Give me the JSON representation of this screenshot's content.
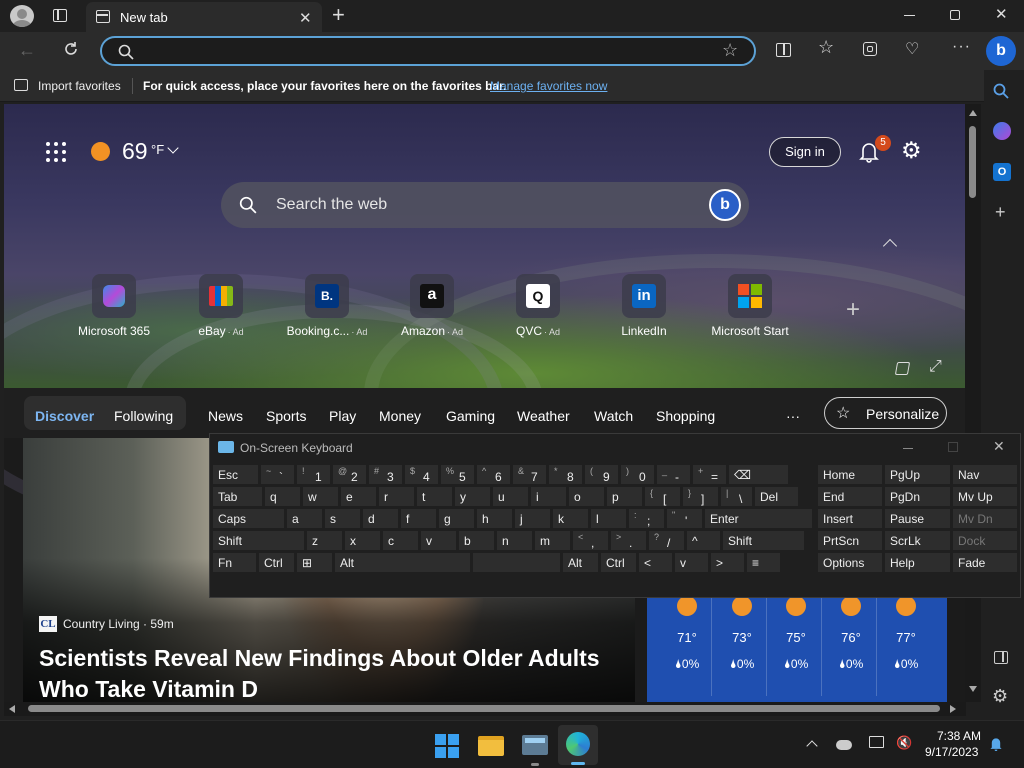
{
  "browser": {
    "tab_title": "New tab",
    "address_value": "",
    "import_favorites": "Import favorites",
    "fav_hint": "For quick access, place your favorites here on the favorites bar.",
    "manage_favorites": "Manage favorites now"
  },
  "hero": {
    "temperature": "69",
    "unit": "°F",
    "sign_in": "Sign in",
    "notification_count": "5",
    "search_placeholder": "Search the web",
    "quick_links": [
      {
        "label": "Microsoft 365",
        "ad": "",
        "icon": "microsoft365-icon"
      },
      {
        "label": "eBay",
        "ad": "· Ad",
        "icon": "ebay-icon"
      },
      {
        "label": "Booking.c...",
        "ad": "· Ad",
        "icon": "booking-icon",
        "glyph": "B."
      },
      {
        "label": "Amazon",
        "ad": "· Ad",
        "icon": "amazon-icon",
        "glyph": "a"
      },
      {
        "label": "QVC",
        "ad": "· Ad",
        "icon": "qvc-icon",
        "glyph": "Q"
      },
      {
        "label": "LinkedIn",
        "ad": "",
        "icon": "linkedin-icon",
        "glyph": "in"
      },
      {
        "label": "Microsoft Start",
        "ad": "",
        "icon": "microsoft-start-icon"
      }
    ]
  },
  "feed_nav": {
    "items": [
      "Discover",
      "Following",
      "News",
      "Sports",
      "Play",
      "Money",
      "Gaming",
      "Weather",
      "Watch",
      "Shopping"
    ],
    "more": "···",
    "personalize": "Personalize"
  },
  "news": {
    "source_badge": "CL",
    "source": "Country Living · 59m",
    "headline_line1": "Scientists Reveal New Findings About Older Adults",
    "headline_line2": "Who Take Vitamin D"
  },
  "weather_forecast": [
    {
      "temp": "71°",
      "precip": "0%"
    },
    {
      "temp": "73°",
      "precip": "0%"
    },
    {
      "temp": "75°",
      "precip": "0%"
    },
    {
      "temp": "76°",
      "precip": "0%"
    },
    {
      "temp": "77°",
      "precip": "0%"
    }
  ],
  "osk": {
    "title": "On-Screen Keyboard",
    "row1": [
      {
        "t": "Esc"
      },
      {
        "u": "~",
        "l": "`"
      },
      {
        "u": "!",
        "l": "1"
      },
      {
        "u": "@",
        "l": "2"
      },
      {
        "u": "#",
        "l": "3"
      },
      {
        "u": "$",
        "l": "4"
      },
      {
        "u": "%",
        "l": "5"
      },
      {
        "u": "^",
        "l": "6"
      },
      {
        "u": "&",
        "l": "7"
      },
      {
        "u": "*",
        "l": "8"
      },
      {
        "u": "(",
        "l": "9"
      },
      {
        "u": ")",
        "l": "0"
      },
      {
        "u": "_",
        "l": "-"
      },
      {
        "u": "+",
        "l": "="
      },
      {
        "t": "⌫"
      }
    ],
    "row2": [
      {
        "t": "Tab"
      },
      {
        "t": "q"
      },
      {
        "t": "w"
      },
      {
        "t": "e"
      },
      {
        "t": "r"
      },
      {
        "t": "t"
      },
      {
        "t": "y"
      },
      {
        "t": "u"
      },
      {
        "t": "i"
      },
      {
        "t": "o"
      },
      {
        "t": "p"
      },
      {
        "u": "{",
        "l": "["
      },
      {
        "u": "}",
        "l": "]"
      },
      {
        "u": "|",
        "l": "\\"
      },
      {
        "t": "Del"
      }
    ],
    "row3": [
      {
        "t": "Caps"
      },
      {
        "t": "a"
      },
      {
        "t": "s"
      },
      {
        "t": "d"
      },
      {
        "t": "f"
      },
      {
        "t": "g"
      },
      {
        "t": "h"
      },
      {
        "t": "j"
      },
      {
        "t": "k"
      },
      {
        "t": "l"
      },
      {
        "u": ":",
        "l": ";"
      },
      {
        "u": "\"",
        "l": "'"
      },
      {
        "t": "Enter"
      }
    ],
    "row4": [
      {
        "t": "Shift"
      },
      {
        "t": "z"
      },
      {
        "t": "x"
      },
      {
        "t": "c"
      },
      {
        "t": "v"
      },
      {
        "t": "b"
      },
      {
        "t": "n"
      },
      {
        "t": "m"
      },
      {
        "u": "<",
        "l": ","
      },
      {
        "u": ">",
        "l": "."
      },
      {
        "u": "?",
        "l": "/"
      },
      {
        "t": "^"
      },
      {
        "t": "Shift"
      }
    ],
    "row5": [
      {
        "t": "Fn"
      },
      {
        "t": "Ctrl"
      },
      {
        "t": "⊞"
      },
      {
        "t": "Alt"
      },
      {
        "t": ""
      },
      {
        "t": "Alt"
      },
      {
        "t": "Ctrl"
      },
      {
        "t": "<"
      },
      {
        "t": "v"
      },
      {
        "t": ">"
      },
      {
        "t": "≡"
      }
    ],
    "nav": [
      [
        "Home",
        "PgUp",
        "Nav"
      ],
      [
        "End",
        "PgDn",
        "Mv Up"
      ],
      [
        "Insert",
        "Pause",
        "Mv Dn"
      ],
      [
        "PrtScn",
        "ScrLk",
        "Dock"
      ],
      [
        "Options",
        "Help",
        "Fade"
      ]
    ]
  },
  "taskbar": {
    "time": "7:38 AM",
    "date": "9/17/2023"
  }
}
